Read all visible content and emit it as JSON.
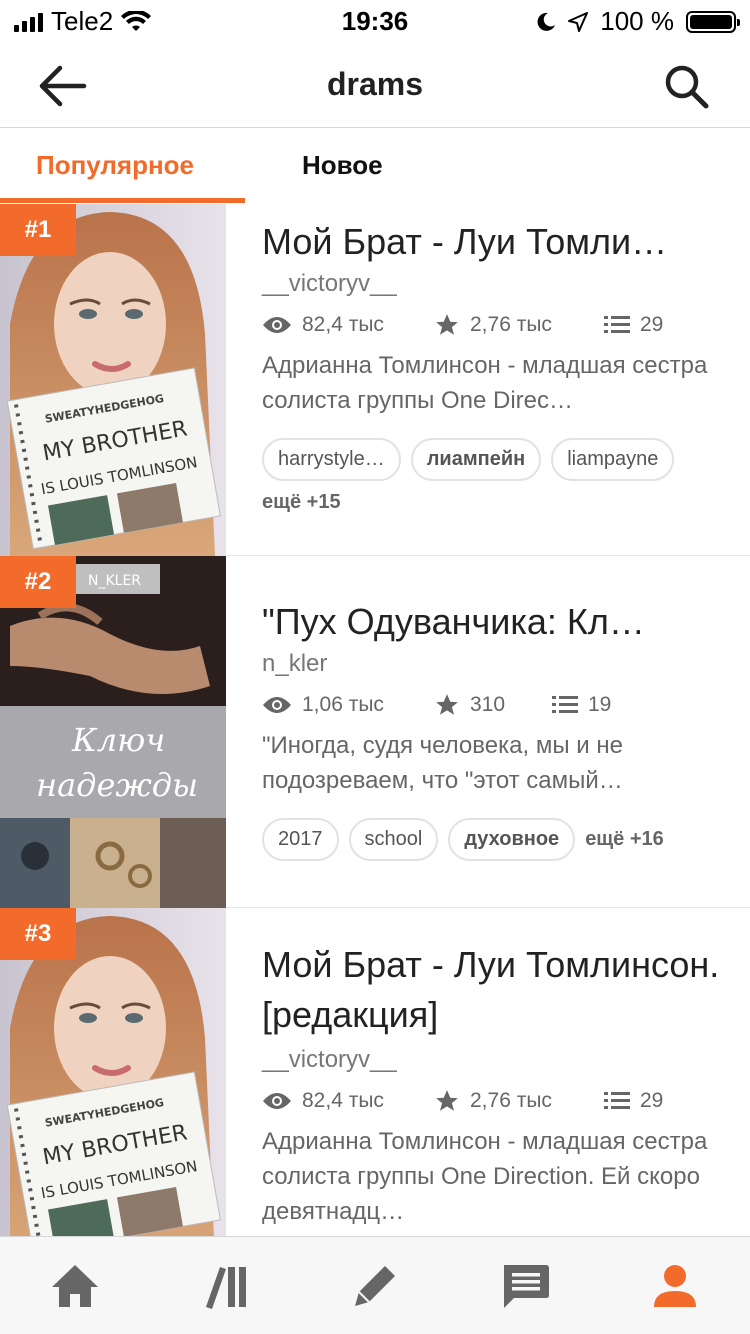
{
  "status_bar": {
    "carrier": "Tele2",
    "time": "19:36",
    "battery": "100 %"
  },
  "header": {
    "title": "drams"
  },
  "tabs": [
    {
      "label": "Популярное",
      "active": true
    },
    {
      "label": "Новое",
      "active": false
    }
  ],
  "colors": {
    "accent": "#f26b2a"
  },
  "stories": [
    {
      "rank": "#1",
      "title": "Мой Брат - Луи Томли…",
      "author": "__victoryv__",
      "reads": "82,4 тыс",
      "votes": "2,76 тыс",
      "parts": "29",
      "description": "Адрианна Томлинсон - младшая сестра солиста группы One Direc…",
      "tags": [
        "harrystyle…",
        "лиампейн",
        "liampayne"
      ],
      "more": "ещё +15",
      "cover_text": [
        "SWEATYHEDGEHOG",
        "MY BROTHER",
        "IS LOUIS TOMLINSON"
      ]
    },
    {
      "rank": "#2",
      "title": "\"Пух Одуванчика: Кл…",
      "author": "n_kler",
      "reads": "1,06 тыс",
      "votes": "310",
      "parts": "19",
      "description": "\"Иногда, судя человека, мы и не подозреваем, что \"этот самый…",
      "tags": [
        "2017",
        "school",
        "духовное"
      ],
      "more": "ещё +16",
      "cover_text": [
        "N_KLER",
        "Ключ",
        "надежды"
      ]
    },
    {
      "rank": "#3",
      "title": "Мой Брат - Луи Томлинсон. [редакция]",
      "author": "__victoryv__",
      "reads": "82,4 тыс",
      "votes": "2,76 тыс",
      "parts": "29",
      "description": "Адрианна Томлинсон - младшая сестра солиста группы One Direction.     Ей скоро девятнадц…",
      "cover_text": [
        "SWEATYHEDGEHOG",
        "MY BROTHER",
        "IS LOUIS TOMLINSON"
      ]
    }
  ],
  "bottom_nav": [
    {
      "icon": "home-icon"
    },
    {
      "icon": "library-icon"
    },
    {
      "icon": "write-icon"
    },
    {
      "icon": "messages-icon"
    },
    {
      "icon": "profile-icon"
    }
  ]
}
